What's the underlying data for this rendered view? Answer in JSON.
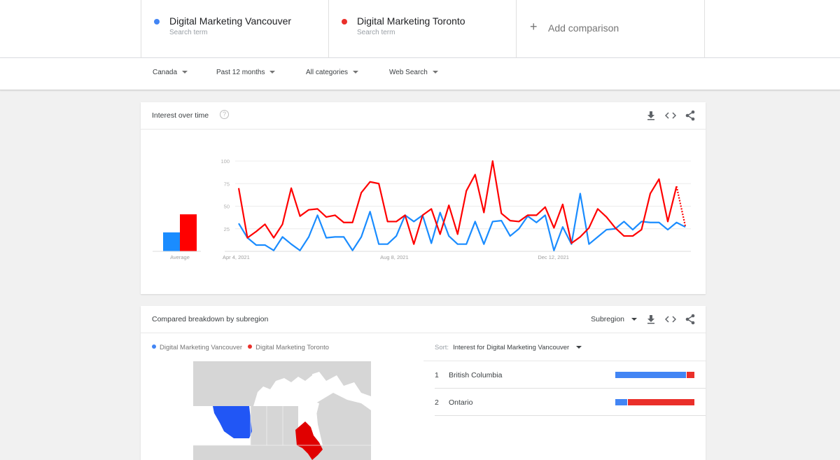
{
  "search_terms": [
    {
      "name": "Digital Marketing Vancouver",
      "subtitle": "Search term",
      "color": "#4285f4"
    },
    {
      "name": "Digital Marketing Toronto",
      "subtitle": "Search term",
      "color": "#ea2f2a"
    }
  ],
  "add_comparison": {
    "label": "Add comparison",
    "icon": "plus-icon"
  },
  "filters": [
    {
      "label": "Canada"
    },
    {
      "label": "Past 12 months"
    },
    {
      "label": "All categories"
    },
    {
      "label": "Web Search"
    }
  ],
  "interest_over_time": {
    "title": "Interest over time",
    "help_icon": "?",
    "icons": [
      "download-icon",
      "embed-icon",
      "share-icon"
    ]
  },
  "chart_data": {
    "type": "line",
    "title": "Interest over time",
    "xlabel": "",
    "ylabel": "",
    "ylim": [
      0,
      100
    ],
    "yticks": [
      25,
      50,
      75,
      100
    ],
    "grid": true,
    "x_tick_labels": [
      {
        "index": 0,
        "label": "Apr 4, 2021"
      },
      {
        "index": 18,
        "label": "Aug 8, 2021"
      },
      {
        "index": 36,
        "label": "Dec 12, 2021"
      }
    ],
    "series": [
      {
        "name": "Digital Marketing Vancouver",
        "color": "#1a8cff",
        "values": [
          31,
          15,
          7,
          7,
          1,
          16,
          8,
          1,
          16,
          40,
          15,
          16,
          16,
          1,
          16,
          44,
          8,
          8,
          17,
          40,
          33,
          40,
          9,
          43,
          17,
          8,
          8,
          33,
          8,
          33,
          34,
          17,
          25,
          39,
          32,
          40,
          1,
          27,
          8,
          64,
          8,
          16,
          24,
          25,
          33,
          24,
          33,
          32,
          32,
          24,
          32,
          27
        ],
        "average": 21
      },
      {
        "name": "Digital Marketing Toronto",
        "color": "#ff0000",
        "values": [
          70,
          15,
          22,
          30,
          15,
          30,
          70,
          39,
          46,
          47,
          38,
          40,
          32,
          32,
          65,
          77,
          75,
          33,
          33,
          40,
          8,
          40,
          47,
          19,
          51,
          19,
          67,
          85,
          43,
          100,
          42,
          34,
          33,
          40,
          40,
          49,
          26,
          52,
          9,
          16,
          26,
          47,
          38,
          26,
          17,
          17,
          24,
          64,
          80,
          33,
          72,
          28
        ],
        "average": 41,
        "partial_last_point": true
      }
    ],
    "average_label": "Average"
  },
  "breakdown": {
    "title": "Compared breakdown by subregion",
    "selector_label": "Subregion",
    "icons": [
      "download-icon",
      "embed-icon",
      "share-icon"
    ],
    "legend": [
      "Digital Marketing Vancouver",
      "Digital Marketing Toronto"
    ],
    "sort_label": "Sort:",
    "sort_value": "Interest for Digital Marketing Vancouver",
    "regions": [
      {
        "rank": "1",
        "name": "British Columbia",
        "vancouver_share": 0.89,
        "toronto_share": 0.11
      },
      {
        "rank": "2",
        "name": "Ontario",
        "vancouver_share": 0.15,
        "toronto_share": 0.85
      }
    ],
    "map": {
      "highlighted": [
        {
          "region": "British Columbia",
          "color": "#2156f5"
        },
        {
          "region": "Ontario",
          "color": "#e00000"
        }
      ]
    }
  }
}
